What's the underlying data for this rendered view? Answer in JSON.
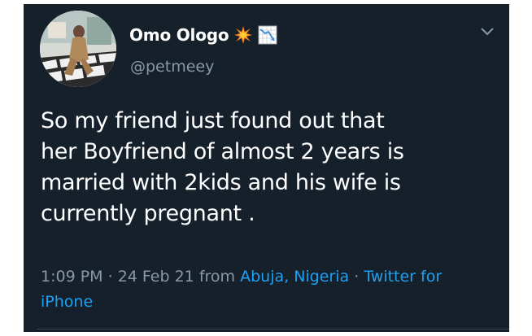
{
  "tweet": {
    "display_name": "Omo Ologo",
    "handle": "@petmeey",
    "name_emojis": [
      "collision-emoji",
      "chart-decreasing-emoji"
    ],
    "text": "So my friend just found out that\nher Boyfriend of almost 2 years is\nmarried with 2kids and his wife is\ncurrently pregnant .",
    "time": "1:09 PM",
    "separator": "·",
    "date": "24 Feb 21",
    "from_label": "from",
    "location": "Abuja, Nigeria",
    "source": "Twitter for iPhone"
  },
  "colors": {
    "background": "#15202b",
    "text_primary": "#ffffff",
    "text_secondary": "#8899a6",
    "accent": "#1da1f2"
  }
}
